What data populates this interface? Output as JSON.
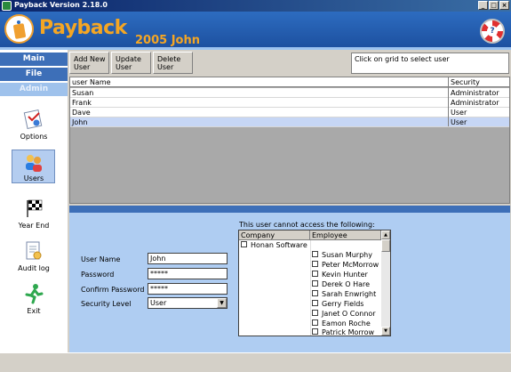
{
  "window": {
    "title": "Payback Version 2.18.0",
    "controls": [
      "_",
      "□",
      "×"
    ]
  },
  "banner": {
    "brand": "Payback",
    "year_user": "2005 John",
    "help_glyph": "?"
  },
  "nav": {
    "tabs": [
      "Main",
      "File",
      "Admin"
    ],
    "active": "Admin"
  },
  "sidebar": {
    "items": [
      {
        "label": "Options",
        "icon": "options-icon"
      },
      {
        "label": "Users",
        "icon": "users-icon",
        "selected": true
      },
      {
        "label": "Year End",
        "icon": "checkered-flag-icon"
      },
      {
        "label": "Audit log",
        "icon": "audit-log-icon"
      },
      {
        "label": "Exit",
        "icon": "exit-icon"
      }
    ]
  },
  "toolbar": {
    "add": [
      "Add New",
      "User"
    ],
    "update": [
      "Update",
      "User"
    ],
    "delete": [
      "Delete",
      "User"
    ]
  },
  "hint": "Click on grid to select user",
  "grid": {
    "columns": [
      "user Name",
      "Security"
    ],
    "rows": [
      [
        "Susan",
        "Administrator"
      ],
      [
        "Frank",
        "Administrator"
      ],
      [
        "Dave",
        "User"
      ],
      [
        "John",
        "User"
      ]
    ],
    "selected_index": 3
  },
  "form": {
    "user_name_label": "User Name",
    "user_name": "John",
    "password_label": "Password",
    "password": "*****",
    "confirm_label": "Confirm Password",
    "confirm": "*****",
    "security_label": "Security Level",
    "security_value": "User"
  },
  "access": {
    "caption": "This user cannot access the following:",
    "columns": [
      "Company",
      "Employee"
    ],
    "companies": [
      "Honan Software"
    ],
    "employees": [
      "Susan Murphy",
      "Peter McMorrow",
      "Kevin Hunter",
      "Derek O Hare",
      "Sarah Enwright",
      "Gerry Fields",
      "Janet O Connor",
      "Eamon Roche",
      "Patrick Morrow"
    ]
  }
}
